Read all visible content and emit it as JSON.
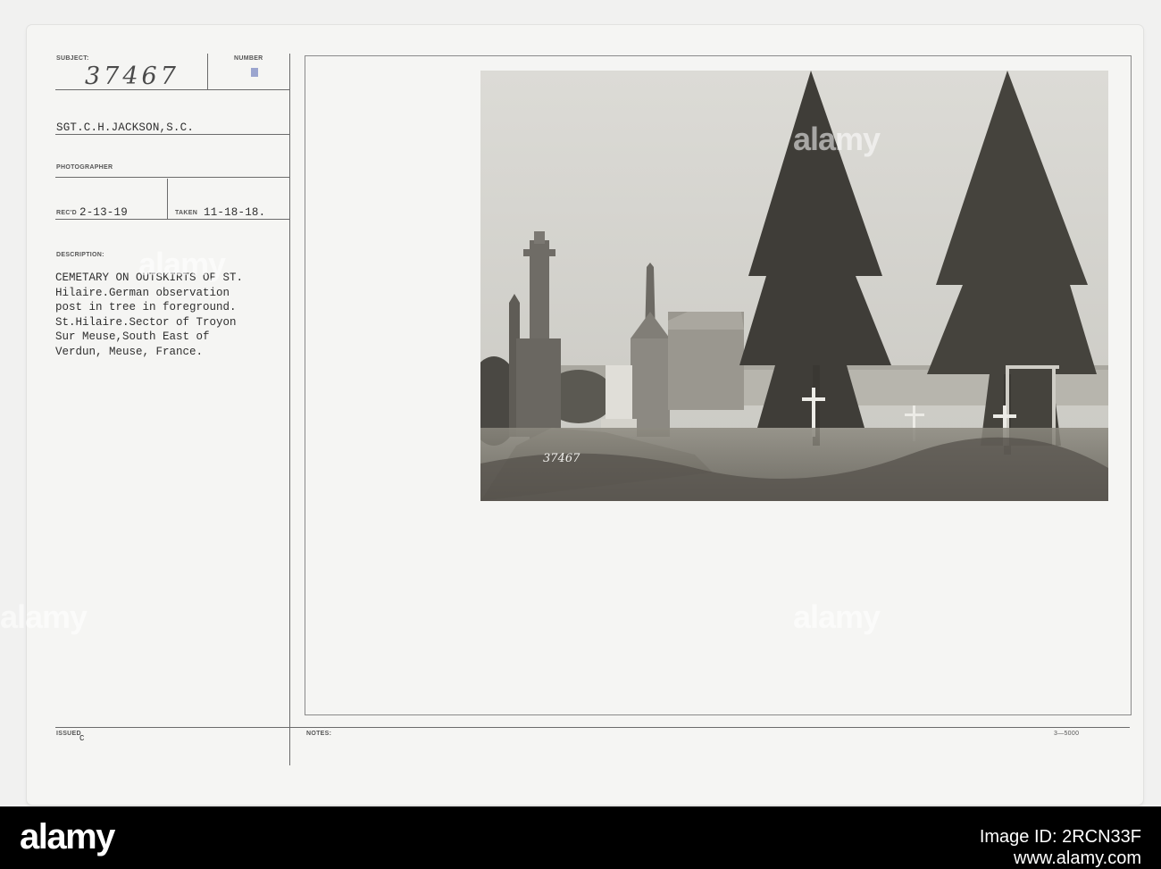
{
  "card": {
    "subject_label": "SUBJECT:",
    "number_label": "NUMBER",
    "subject_number": "37467",
    "photographer_name": "SGT.C.H.JACKSON,S.C.",
    "photographer_label": "PHOTOGRAPHER",
    "recd_label": "REC'D",
    "recd_date": "2-13-19",
    "taken_label": "TAKEN",
    "taken_date": "11-18-18.",
    "description_label": "DESCRIPTION:",
    "description_lines": [
      "CEMETARY ON OUTSKIRTS OF ST.",
      "Hilaire.German observation",
      "post in tree in foreground.",
      "St.Hilaire.Sector of Troyon",
      "Sur Meuse,South East of",
      "Verdun, Meuse, France."
    ],
    "issued_label": "ISSUED",
    "issued_mark": "C",
    "notes_label": "NOTES:",
    "form_code": "3—5000"
  },
  "photo": {
    "plate_number": "37467"
  },
  "watermark": {
    "text": "alamy"
  },
  "footer": {
    "logo_text": "alamy",
    "image_id": "Image ID: 2RCN33F",
    "site": "www.alamy.com"
  },
  "colors": {
    "paper": "#f5f5f3",
    "ink": "#2f2f2f",
    "rule": "#6b6b6b",
    "stamp_blue": "#8b97c8",
    "sepia_sky": "#d9d8d3",
    "footer_bg": "#000000"
  }
}
